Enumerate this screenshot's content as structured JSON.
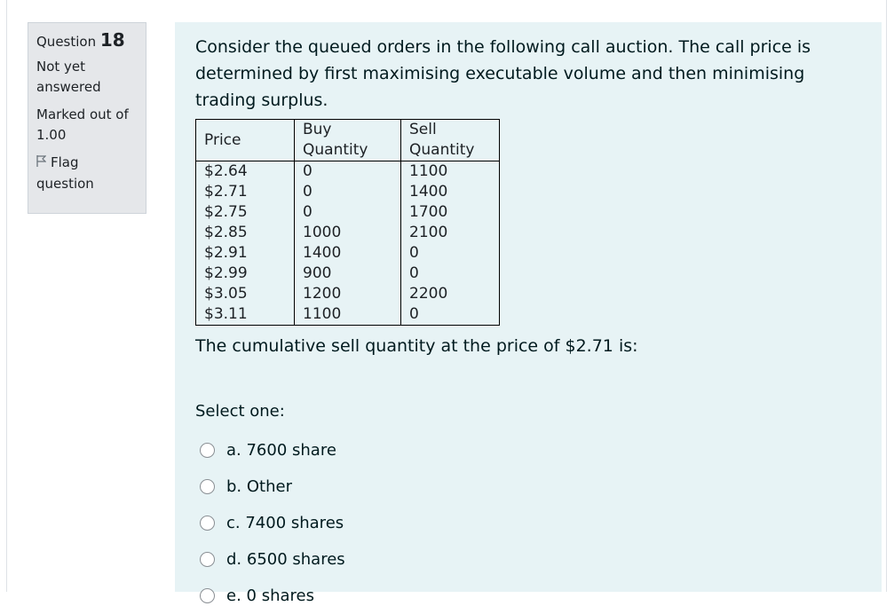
{
  "info": {
    "question_label": "Question",
    "question_number": "18",
    "status": "Not yet answered",
    "marked_out_of": "Marked out of 1.00",
    "flag_label": "Flag question"
  },
  "question": {
    "intro": "Consider the queued orders in the following call auction.  The call price is determined by first maximising executable volume and then minimising trading surplus.",
    "table": {
      "headers": [
        "Price",
        "Buy Quantity",
        "Sell Quantity"
      ],
      "rows": [
        [
          "$2.64",
          "0",
          "1100"
        ],
        [
          "$2.71",
          "0",
          "1400"
        ],
        [
          "$2.75",
          "0",
          "1700"
        ],
        [
          "$2.85",
          "1000",
          "2100"
        ],
        [
          "$2.91",
          "1400",
          "0"
        ],
        [
          "$2.99",
          "900",
          "0"
        ],
        [
          "$3.05",
          "1200",
          "2200"
        ],
        [
          "$3.11",
          "1100",
          "0"
        ]
      ]
    },
    "prompt": "The cumulative sell quantity at the price of $2.71 is:",
    "select_label": "Select one:",
    "options": [
      "a. 7600 share",
      "b. Other",
      "c. 7400 shares",
      "d. 6500 shares",
      "e. 0 shares"
    ]
  }
}
